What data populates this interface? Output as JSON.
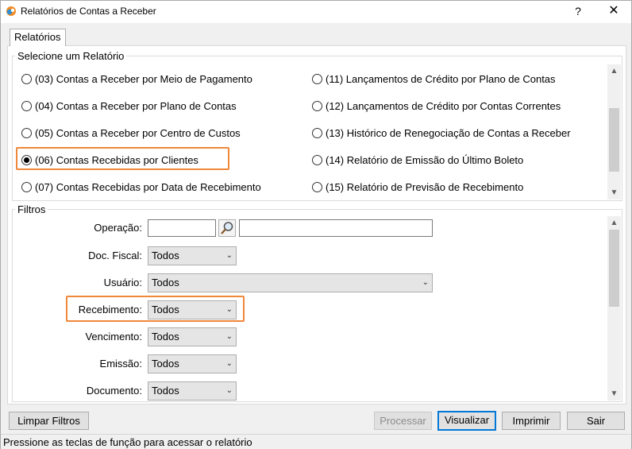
{
  "window": {
    "title": "Relatórios de Contas a Receber",
    "help_label": "?",
    "close_label": "✕"
  },
  "tab": {
    "label": "Relatórios"
  },
  "report_group": {
    "label": "Selecione um Relatório",
    "left_items": [
      {
        "label": "(03) Contas a Receber por Meio de Pagamento",
        "checked": false
      },
      {
        "label": "(04) Contas a Receber por Plano de Contas",
        "checked": false
      },
      {
        "label": "(05) Contas a Receber por Centro de Custos",
        "checked": false
      },
      {
        "label": "(06) Contas Recebidas por Clientes",
        "checked": true
      },
      {
        "label": "(07) Contas Recebidas por Data de Recebimento",
        "checked": false
      }
    ],
    "right_items": [
      {
        "label": "(11) Lançamentos de Crédito por Plano de Contas",
        "checked": false
      },
      {
        "label": "(12) Lançamentos de Crédito por Contas Correntes",
        "checked": false
      },
      {
        "label": "(13) Histórico de Renegociação de Contas a Receber",
        "checked": false
      },
      {
        "label": "(14) Relatório de Emissão do Último Boleto",
        "checked": false
      },
      {
        "label": "(15) Relatório de Previsão de Recebimento",
        "checked": false
      }
    ]
  },
  "filters": {
    "label": "Filtros",
    "operacao": {
      "label": "Operação:",
      "value": "",
      "description": ""
    },
    "doc_fiscal": {
      "label": "Doc. Fiscal:",
      "value": "Todos"
    },
    "usuario": {
      "label": "Usuário:",
      "value": "Todos"
    },
    "recebimento": {
      "label": "Recebimento:",
      "value": "Todos"
    },
    "vencimento": {
      "label": "Vencimento:",
      "value": "Todos"
    },
    "emissao": {
      "label": "Emissão:",
      "value": "Todos"
    },
    "documento": {
      "label": "Documento:",
      "value": "Todos"
    }
  },
  "buttons": {
    "limpar": "Limpar Filtros",
    "processar": "Processar",
    "visualizar": "Visualizar",
    "imprimir": "Imprimir",
    "sair": "Sair"
  },
  "status": "Pressione as teclas de função para acessar o relatório",
  "colors": {
    "highlight": "#f0883a",
    "focus": "#0078d7"
  }
}
